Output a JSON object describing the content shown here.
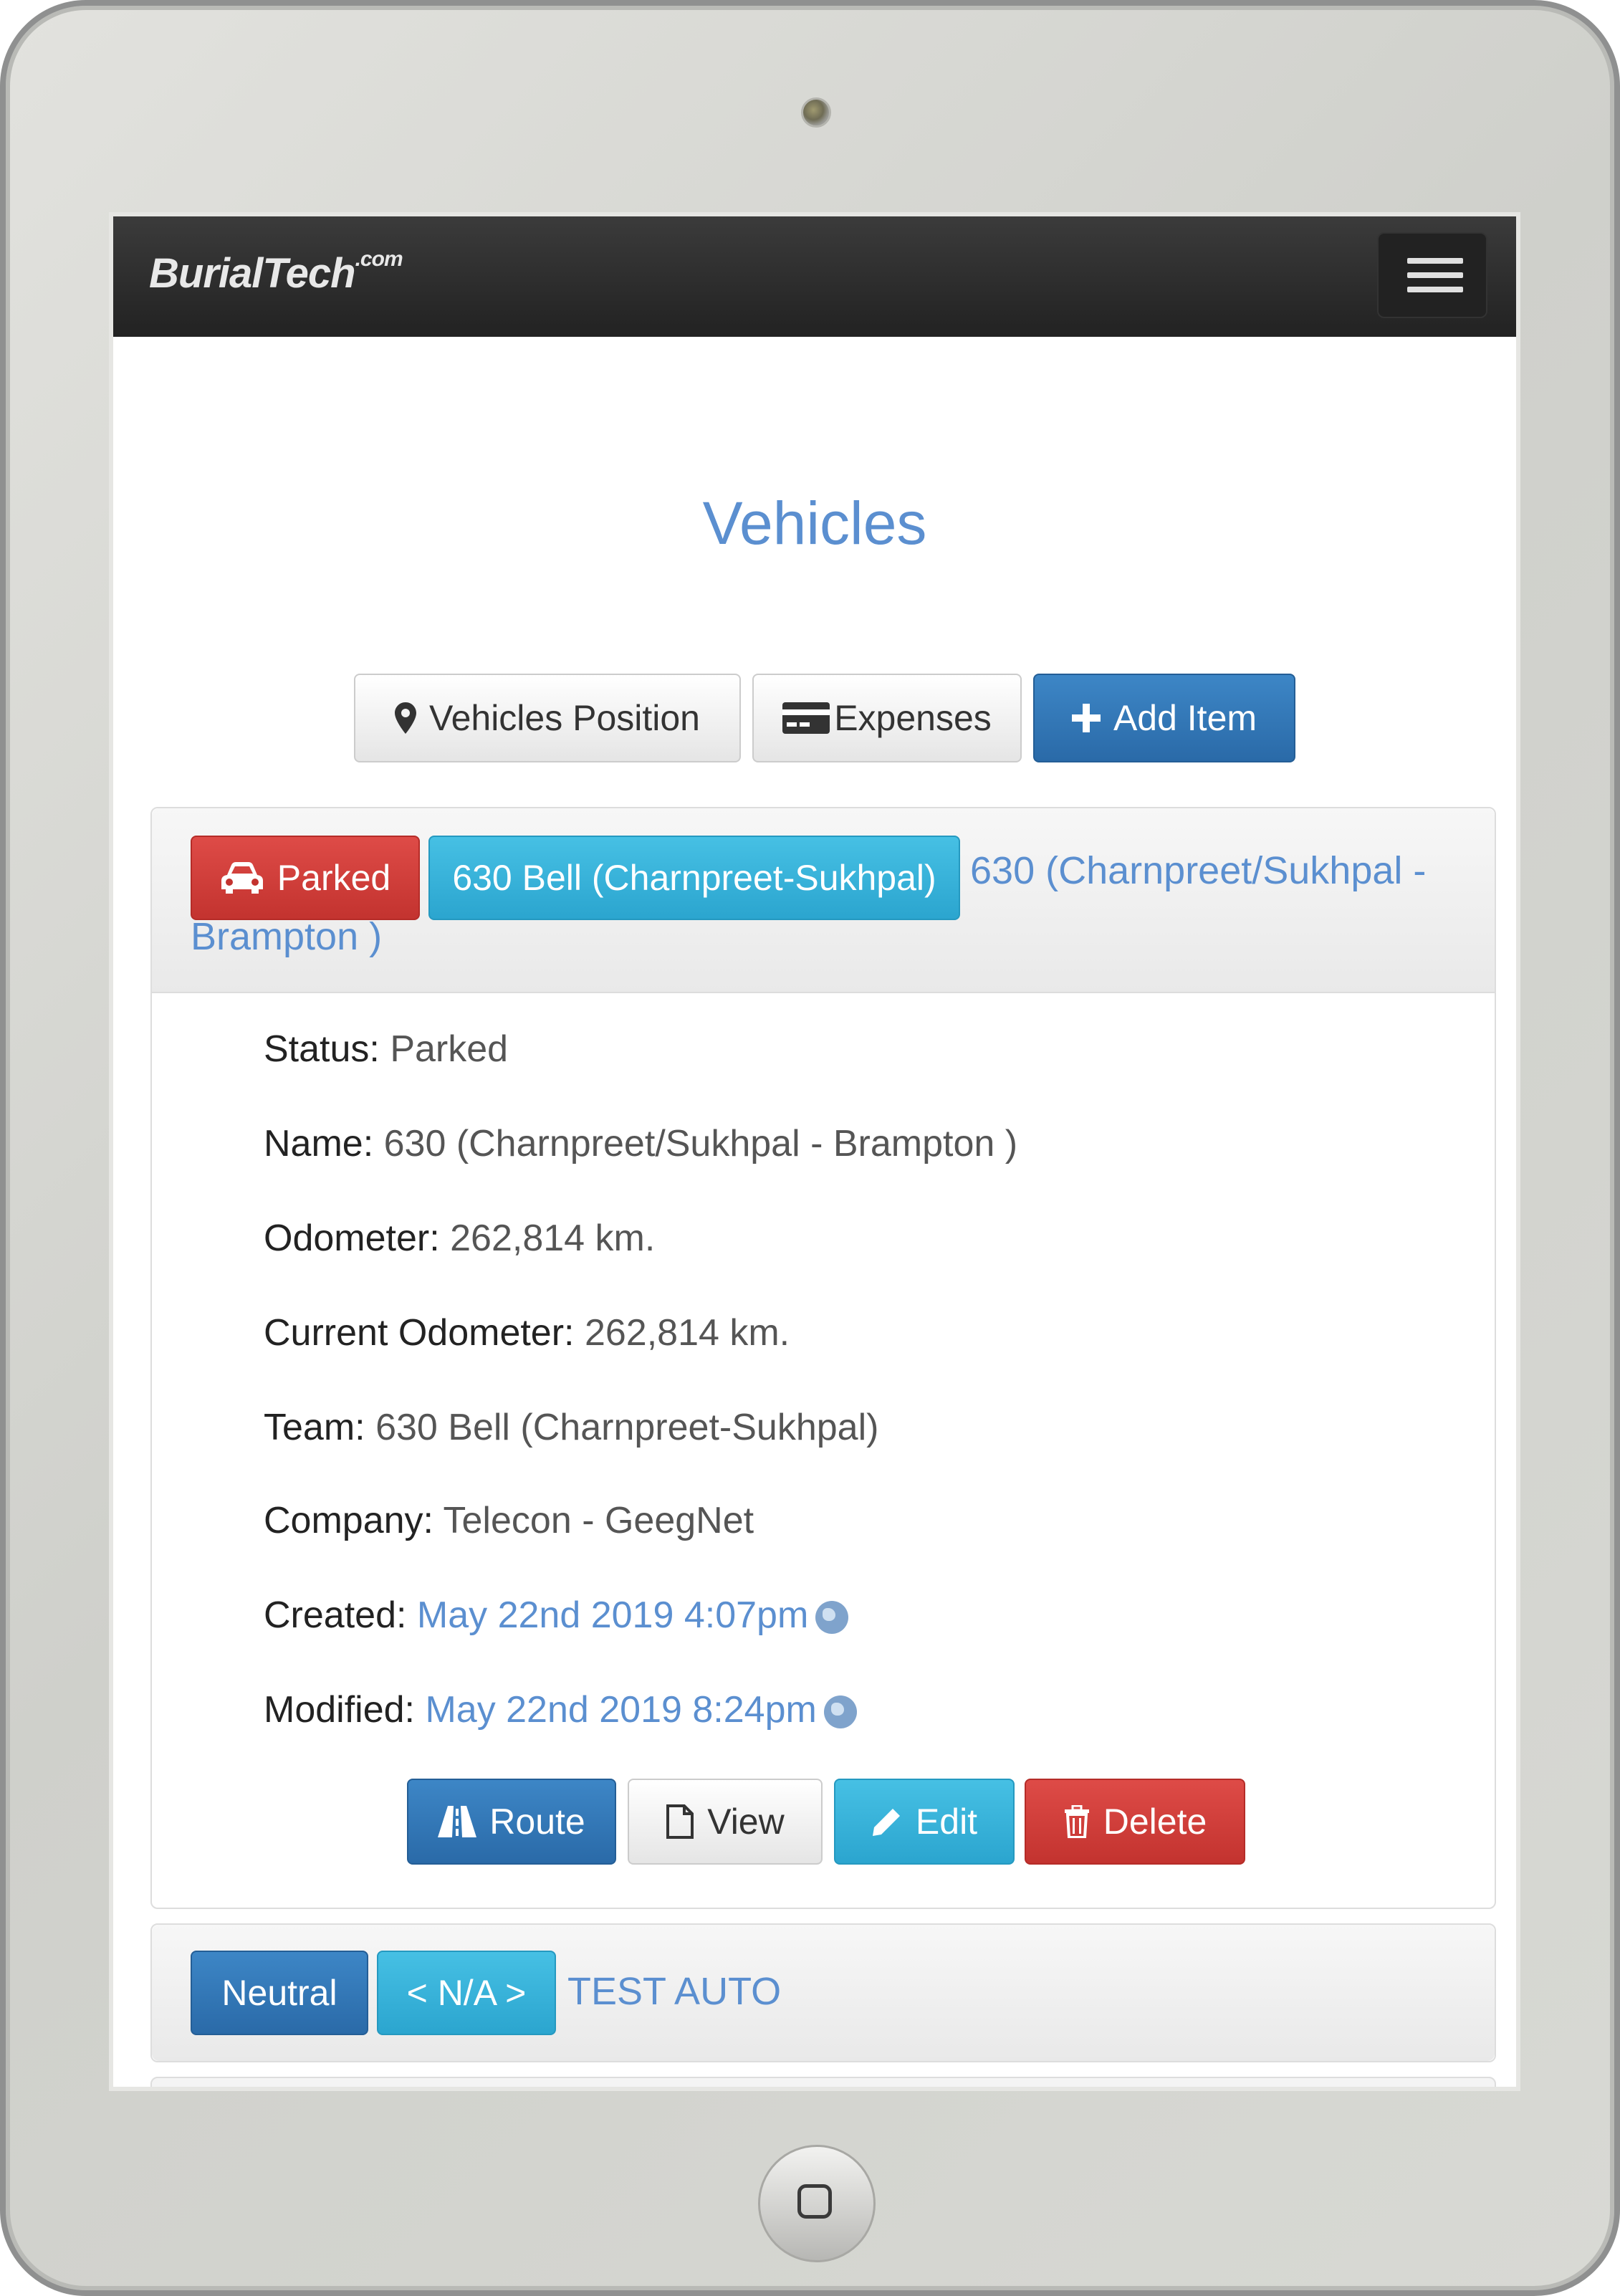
{
  "navbar": {
    "brand": "BurialTech",
    "brand_suffix": ".com"
  },
  "page": {
    "title": "Vehicles"
  },
  "toolbar": {
    "position_label": "Vehicles Position",
    "expenses_label": "Expenses",
    "add_label": "Add Item"
  },
  "vehicles": [
    {
      "status_badge": "Parked",
      "team_badge": "630 Bell (Charnpreet-Sukhpal)",
      "name_link_line1": "630 (Charnpreet/Sukhpal -",
      "name_link_line2": "Brampton )",
      "details": {
        "status_label": "Status:",
        "status_value": "Parked",
        "name_label": "Name:",
        "name_value": "630 (Charnpreet/Sukhpal - Brampton )",
        "odometer_label": "Odometer:",
        "odometer_value": "262,814 km.",
        "current_odometer_label": "Current Odometer:",
        "current_odometer_value": "262,814 km.",
        "team_label": "Team:",
        "team_value": "630 Bell (Charnpreet-Sukhpal)",
        "company_label": "Company:",
        "company_value": "Telecon - GeegNet",
        "created_label": "Created:",
        "created_value": "May 22nd 2019 4:07pm",
        "modified_label": "Modified:",
        "modified_value": "May 22nd 2019 8:24pm"
      },
      "actions": {
        "route": "Route",
        "view": "View",
        "edit": "Edit",
        "delete": "Delete"
      }
    },
    {
      "status_badge": "Neutral",
      "team_badge": "< N/A >",
      "name_link": "TEST AUTO"
    }
  ],
  "colors": {
    "link": "#5b8fd0",
    "primary": "#2a6aa8",
    "info": "#2ba5cf",
    "danger": "#c3332f",
    "navbar": "#222222"
  }
}
